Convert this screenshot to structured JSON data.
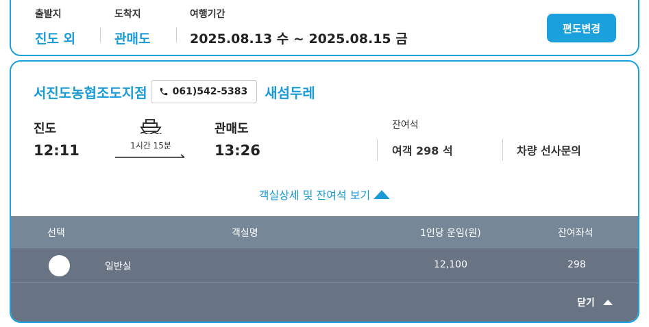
{
  "summary": {
    "departure_label": "출발지",
    "departure_value": "진도 외",
    "arrival_label": "도착지",
    "arrival_value": "관매도",
    "period_label": "여행기간",
    "period_value": "2025.08.13 수 ~ 2025.08.15 금",
    "change_button": "편도변경"
  },
  "voyage": {
    "operator": "서진도농협조도지점",
    "phone": "061)542-5383",
    "ship_name": "새섬두레",
    "from_port": "진도",
    "from_time": "12:11",
    "to_port": "관매도",
    "to_time": "13:26",
    "duration": "1시간 15분",
    "remaining_label": "잔여석",
    "passenger_seats": "여객 298 석",
    "vehicle_seats": "차량 선사문의",
    "details_toggle": "객실상세 및 잔여석 보기"
  },
  "cabin_table": {
    "headers": [
      "선택",
      "객실명",
      "1인당 운임(원)",
      "잔여좌석"
    ],
    "rows": [
      {
        "name": "일반실",
        "fare": "12,100",
        "remaining": "298"
      }
    ],
    "close_label": "닫기"
  },
  "colors": {
    "accent": "#1aa0dc",
    "table_header": "#768897",
    "table_body": "#687483"
  },
  "icons": [
    "phone-icon",
    "ship-icon",
    "arrow-right-icon",
    "triangle-up-icon",
    "radio-button"
  ]
}
